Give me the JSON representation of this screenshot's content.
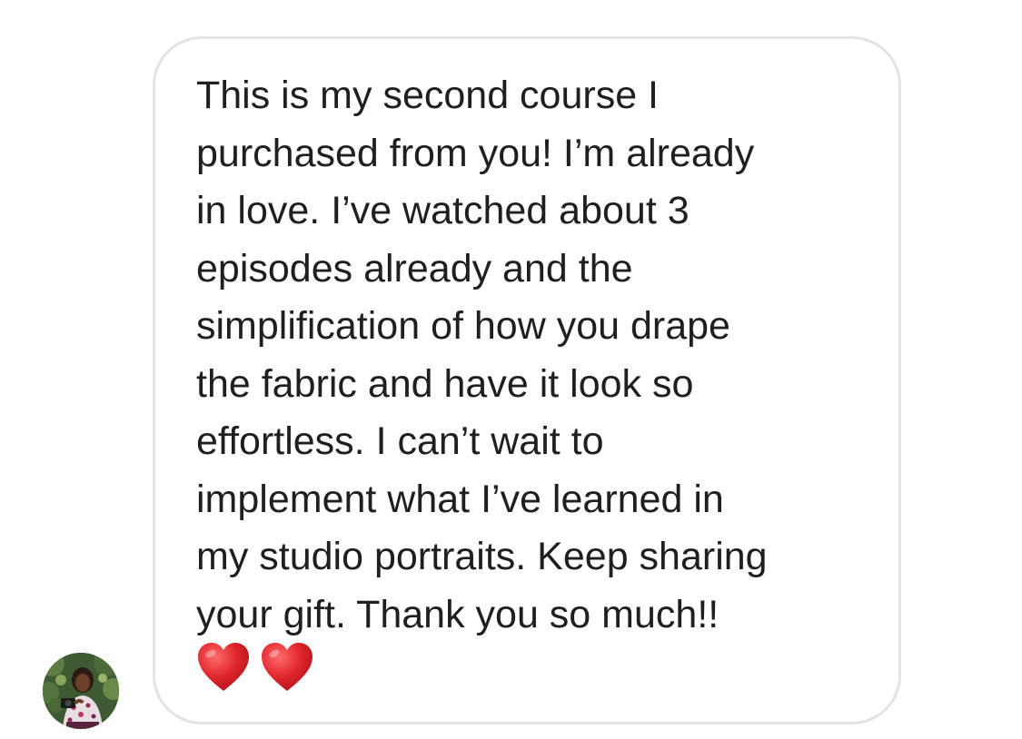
{
  "message": {
    "lines": [
      "This is my second course I",
      "purchased from you! I’m already",
      "in love. I’ve watched about 3",
      "episodes already and the",
      "simplification of how you drape",
      "the fabric and have it look so",
      "effortless. I can’t wait to",
      "implement what I’ve learned in",
      "my studio portraits. Keep sharing",
      "your gift. Thank you so much!!"
    ],
    "emojis": [
      "red-heart-icon",
      "red-heart-icon"
    ]
  },
  "sender": {
    "avatar_icon": "profile-photo-avatar"
  },
  "colors": {
    "text": "#1f1f1f",
    "bubble_border": "#e3e3e3",
    "heart": "#e0262d",
    "background": "#ffffff"
  }
}
